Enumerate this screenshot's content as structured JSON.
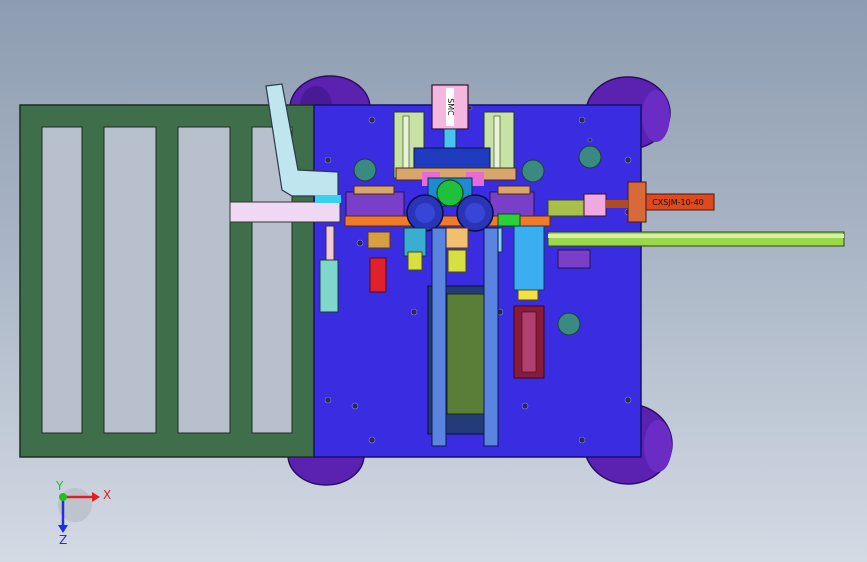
{
  "view": {
    "background_top": "#8d9cb0",
    "background_bottom": "#d3dae4",
    "plate_color": "#3a2ce0",
    "frame_color": "#3f6f4a",
    "wheel_color": "#5a1fb0"
  },
  "axes": {
    "x_label": "X",
    "y_label": "Y",
    "z_label": "Z",
    "x_color": "#e02020",
    "y_color": "#20c020",
    "z_color": "#2030e0"
  },
  "parts": {
    "cylinder_label": "CXSJM-10-40",
    "top_block_label": "SMC"
  }
}
